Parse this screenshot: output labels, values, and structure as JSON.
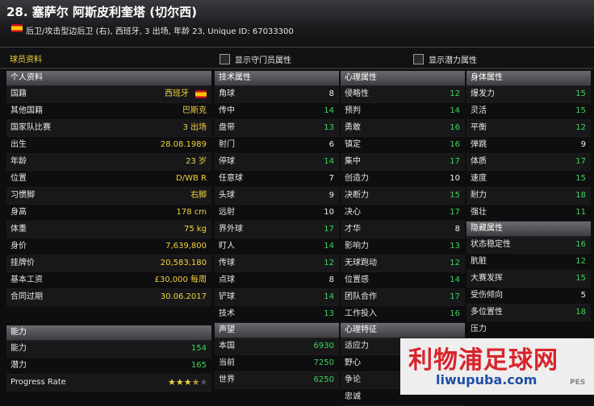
{
  "header": {
    "title": "28. 塞萨尔 阿斯皮利奎塔 (切尔西)",
    "subtitle": "后卫/攻击型边后卫 (右), 西班牙, 3 出场, 年龄 23, Unique ID: 67033300",
    "flag_colors": [
      "#c60b1e",
      "#ffc400"
    ]
  },
  "topbar": {
    "section_label": "球员资料",
    "checkbox_gk": "显示守门员属性",
    "checkbox_potential": "显示潜力属性"
  },
  "personal": {
    "title": "个人资料",
    "rows": [
      {
        "label": "国籍",
        "value": "西班牙"
      },
      {
        "label": "其他国籍",
        "value": "巴斯克"
      },
      {
        "label": "国家队比赛",
        "value": "3 出场"
      },
      {
        "label": "出生",
        "value": "28.08.1989"
      },
      {
        "label": "年龄",
        "value": "23 岁"
      },
      {
        "label": "位置",
        "value": "D/WB R"
      },
      {
        "label": "习惯脚",
        "value": "右脚"
      },
      {
        "label": "身高",
        "value": "178 cm"
      },
      {
        "label": "体重",
        "value": "75 kg"
      },
      {
        "label": "身价",
        "value": "7,639,800"
      },
      {
        "label": "挂牌价",
        "value": "20,583,180"
      },
      {
        "label": "基本工资",
        "value": "£30,000 每周"
      },
      {
        "label": "合同过期",
        "value": "30.06.2017"
      }
    ]
  },
  "ability": {
    "title": "能力",
    "rows": [
      {
        "label": "能力",
        "value": "154"
      },
      {
        "label": "潜力",
        "value": "165"
      },
      {
        "label": "Progress Rate",
        "value": ""
      }
    ],
    "progress_stars": 3.5
  },
  "technical": {
    "title": "技术属性",
    "rows": [
      {
        "label": "角球",
        "value": "8"
      },
      {
        "label": "传中",
        "value": "14"
      },
      {
        "label": "盘带",
        "value": "13"
      },
      {
        "label": "射门",
        "value": "6"
      },
      {
        "label": "停球",
        "value": "14"
      },
      {
        "label": "任意球",
        "value": "7"
      },
      {
        "label": "头球",
        "value": "9"
      },
      {
        "label": "远射",
        "value": "10"
      },
      {
        "label": "界外球",
        "value": "17"
      },
      {
        "label": "盯人",
        "value": "14"
      },
      {
        "label": "传球",
        "value": "12"
      },
      {
        "label": "点球",
        "value": "8"
      },
      {
        "label": "铲球",
        "value": "14"
      },
      {
        "label": "技术",
        "value": "13"
      }
    ]
  },
  "reputation": {
    "title": "声望",
    "rows": [
      {
        "label": "本国",
        "value": "6930"
      },
      {
        "label": "当前",
        "value": "7250"
      },
      {
        "label": "世界",
        "value": "6250"
      }
    ]
  },
  "mental": {
    "title": "心理属性",
    "rows": [
      {
        "label": "侵略性",
        "value": "12"
      },
      {
        "label": "预判",
        "value": "14"
      },
      {
        "label": "勇敢",
        "value": "16"
      },
      {
        "label": "镇定",
        "value": "16"
      },
      {
        "label": "集中",
        "value": "17"
      },
      {
        "label": "创造力",
        "value": "10"
      },
      {
        "label": "决断力",
        "value": "15"
      },
      {
        "label": "决心",
        "value": "17"
      },
      {
        "label": "才华",
        "value": "8"
      },
      {
        "label": "影响力",
        "value": "13"
      },
      {
        "label": "无球跑动",
        "value": "12"
      },
      {
        "label": "位置感",
        "value": "14"
      },
      {
        "label": "团队合作",
        "value": "17"
      },
      {
        "label": "工作投入",
        "value": "16"
      }
    ]
  },
  "mental_traits": {
    "title": "心理特征",
    "rows": [
      {
        "label": "适应力",
        "value": "12"
      },
      {
        "label": "野心",
        "value": ""
      },
      {
        "label": "争论",
        "value": ""
      },
      {
        "label": "忠诚",
        "value": ""
      }
    ]
  },
  "physical": {
    "title": "身体属性",
    "rows": [
      {
        "label": "爆发力",
        "value": "15"
      },
      {
        "label": "灵活",
        "value": "15"
      },
      {
        "label": "平衡",
        "value": "12"
      },
      {
        "label": "弹跳",
        "value": "9"
      },
      {
        "label": "体质",
        "value": "17"
      },
      {
        "label": "速度",
        "value": "15"
      },
      {
        "label": "耐力",
        "value": "18"
      },
      {
        "label": "强壮",
        "value": "11"
      }
    ]
  },
  "hidden": {
    "title": "隐藏属性",
    "rows": [
      {
        "label": "状态稳定性",
        "value": "16"
      },
      {
        "label": "肮脏",
        "value": "12"
      },
      {
        "label": "大赛发挥",
        "value": "15"
      },
      {
        "label": "受伤倾向",
        "value": "5"
      },
      {
        "label": "多位置性",
        "value": "18"
      },
      {
        "label": "压力",
        "value": ""
      }
    ]
  },
  "watermark": {
    "line1": "利物浦足球网",
    "line2": "liwupuba.com",
    "logo": "PES"
  }
}
